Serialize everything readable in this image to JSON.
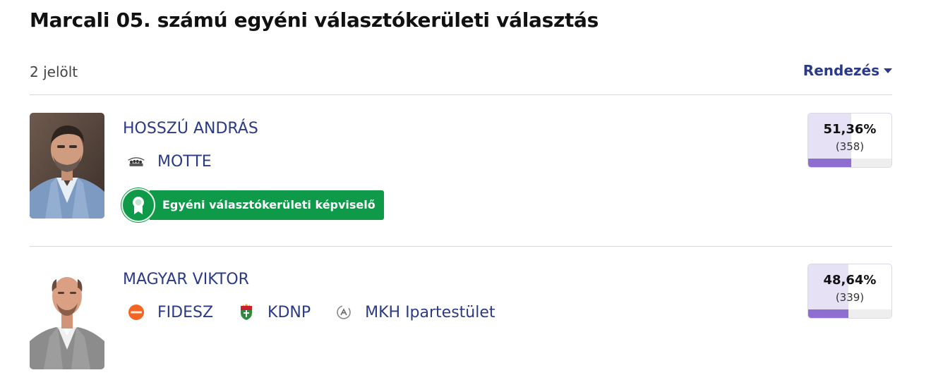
{
  "page": {
    "title": "Marcali 05. számú egyéni választókerületi választás",
    "count_label": "2 jelölt",
    "sort_label": "Rendezés"
  },
  "candidates": [
    {
      "name": "HOSSZÚ ANDRÁS",
      "parties": [
        {
          "name": "MOTTE",
          "icon": "motte-logo-icon"
        }
      ],
      "badge": "Egyéni választókerületi képviselő",
      "percent_label": "51,36%",
      "votes_label": "(358)",
      "share": 51.36
    },
    {
      "name": "MAGYAR VIKTOR",
      "parties": [
        {
          "name": "FIDESZ",
          "icon": "fidesz-logo-icon"
        },
        {
          "name": "KDNP",
          "icon": "kdnp-logo-icon"
        },
        {
          "name": "MKH Ipartestület",
          "icon": "mkh-ipartestulet-logo-icon"
        }
      ],
      "badge": "",
      "percent_label": "48,64%",
      "votes_label": "(339)",
      "share": 48.64
    }
  ],
  "colors": {
    "accent": "#2b3a86",
    "winner_green": "#0f9a4a",
    "result_bar": "#8f6ed2",
    "result_fill": "#e6e1f4",
    "fidesz_orange": "#f26522"
  }
}
